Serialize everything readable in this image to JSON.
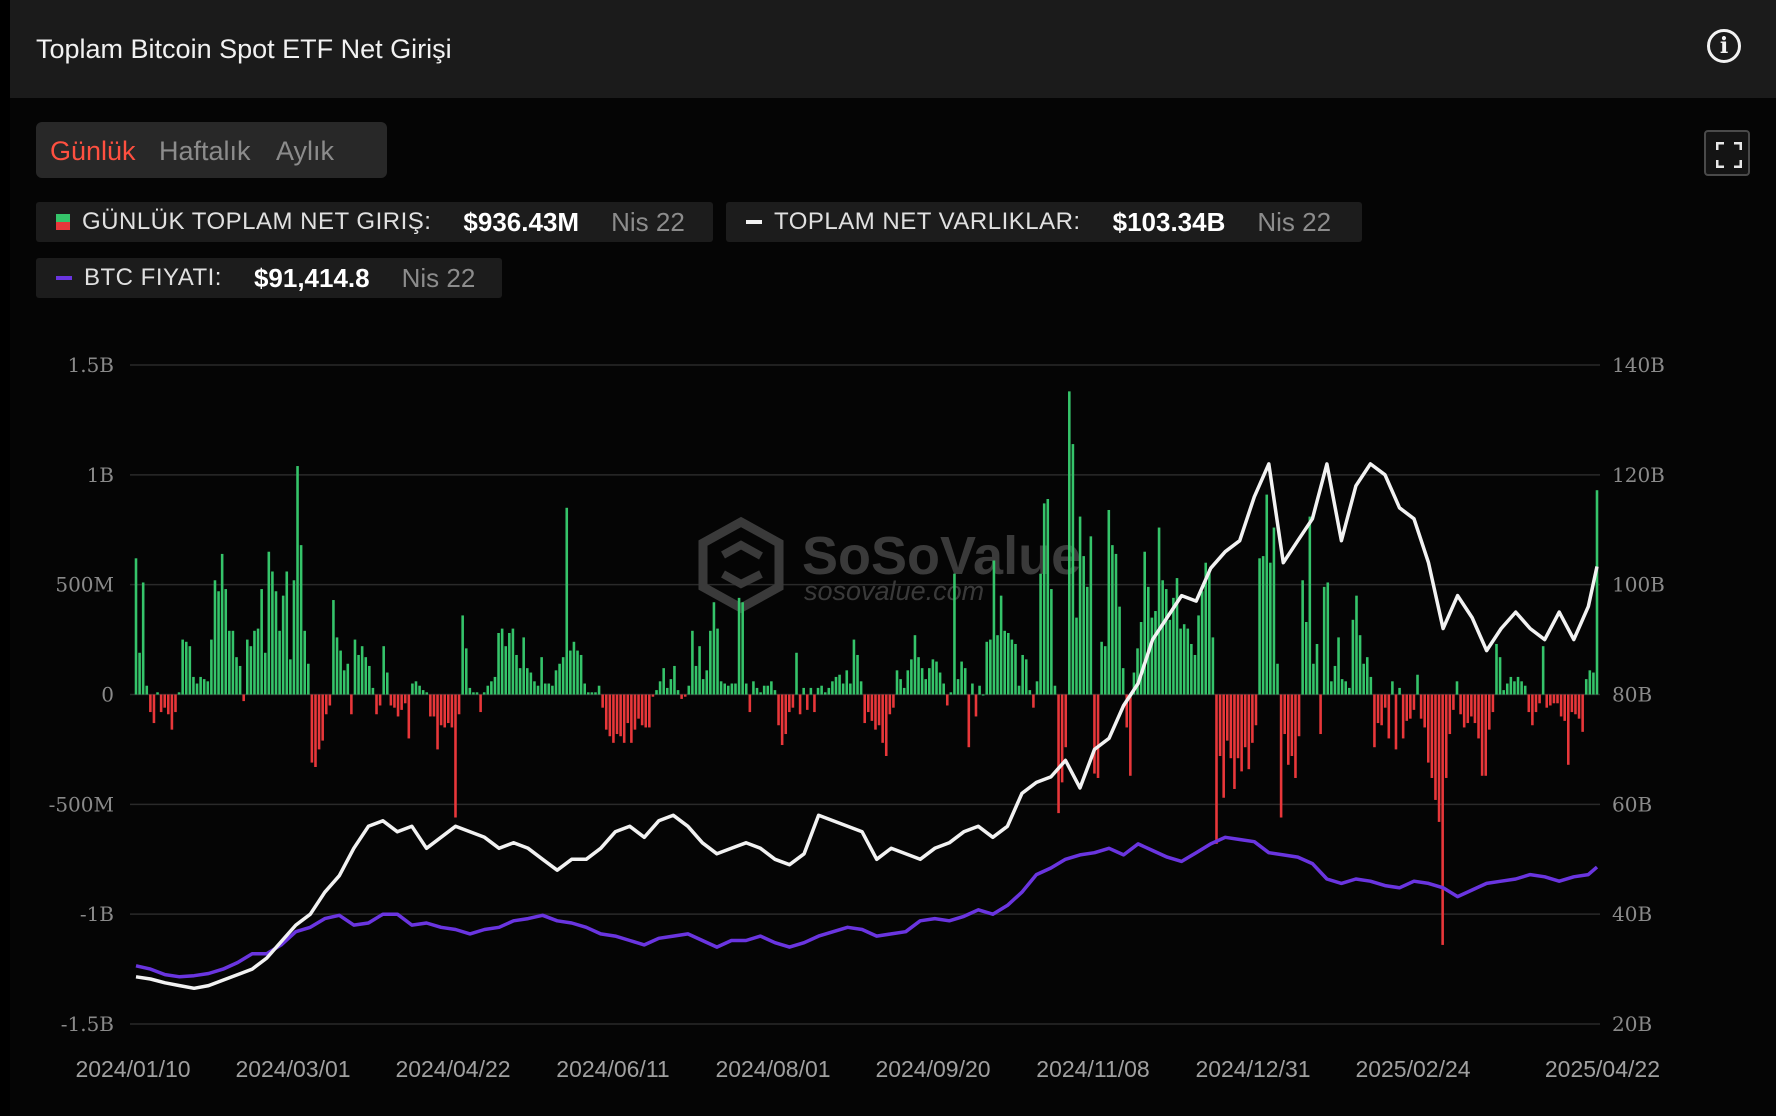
{
  "header": {
    "title": "Toplam Bitcoin Spot ETF Net Girişi",
    "info_icon": "info-icon"
  },
  "tabs": [
    {
      "label": "Günlük",
      "active": true
    },
    {
      "label": "Haftalık",
      "active": false
    },
    {
      "label": "Aylık",
      "active": false
    }
  ],
  "legend": {
    "daily": {
      "label": "GÜNLÜK TOPLAM NET GIRIŞ:",
      "value": "$936.43M",
      "date": "Nis 22"
    },
    "assets": {
      "label": "TOPLAM NET VARLIKLAR:",
      "value": "$103.34B",
      "date": "Nis 22"
    },
    "price": {
      "label": "BTC FIYATI:",
      "value": "$91,414.8",
      "date": "Nis 22"
    }
  },
  "watermark": {
    "brand": "SoSoValue",
    "site": "sosovalue.com"
  },
  "colors": {
    "inflow": "#35c46a",
    "outflow": "#e8373a",
    "assets": "#f2f2f2",
    "price": "#6a35e0",
    "active_tab": "#ff5040"
  },
  "chart_data": {
    "type": "bar+line",
    "left_axis": {
      "ticks": [
        "1.5B",
        "1B",
        "500M",
        "0",
        "-500M",
        "-1B",
        "-1.5B"
      ],
      "range": [
        -1.5,
        1.5
      ]
    },
    "right_axis": {
      "ticks": [
        "140B",
        "120B",
        "100B",
        "80B",
        "60B",
        "40B",
        "20B"
      ],
      "range": [
        20,
        140
      ]
    },
    "x_ticks": [
      "2024/01/10",
      "2024/03/01",
      "2024/04/22",
      "2024/06/11",
      "2024/08/01",
      "2024/09/20",
      "2024/11/08",
      "2024/12/31",
      "2025/02/24",
      "2025/04/22"
    ],
    "daily_flows_billions": [
      0.62,
      0.19,
      0.51,
      0.04,
      -0.08,
      -0.13,
      0.01,
      -0.08,
      -0.06,
      -0.09,
      -0.16,
      -0.08,
      0.01,
      0.25,
      0.24,
      0.22,
      0.08,
      0.05,
      0.08,
      0.07,
      0.06,
      0.25,
      0.52,
      0.47,
      0.64,
      0.48,
      0.29,
      0.29,
      0.17,
      0.13,
      -0.03,
      0.25,
      0.22,
      0.29,
      0.3,
      0.48,
      0.19,
      0.65,
      0.56,
      0.47,
      0.29,
      0.45,
      0.56,
      0.16,
      0.52,
      1.04,
      0.68,
      0.29,
      0.14,
      -0.31,
      -0.33,
      -0.25,
      -0.21,
      -0.09,
      -0.05,
      0.43,
      0.26,
      0.2,
      0.11,
      0.14,
      -0.09,
      0.25,
      0.18,
      0.22,
      0.17,
      0.13,
      0.03,
      -0.09,
      -0.05,
      0.22,
      0.1,
      -0.05,
      -0.06,
      -0.1,
      -0.07,
      -0.04,
      -0.2,
      0.05,
      0.06,
      0.04,
      0.02,
      0.01,
      -0.1,
      -0.1,
      -0.25,
      -0.14,
      -0.15,
      -0.13,
      -0.15,
      -0.56,
      -0.09,
      0.36,
      0.21,
      0.03,
      0.01,
      0.01,
      -0.08,
      0.01,
      0.04,
      0.06,
      0.08,
      0.28,
      0.3,
      0.22,
      0.28,
      0.3,
      0.18,
      0.12,
      0.26,
      0.12,
      0.1,
      0.06,
      0.04,
      0.17,
      0.05,
      0.05,
      0.04,
      0.11,
      0.14,
      0.17,
      0.85,
      0.2,
      0.24,
      0.2,
      0.18,
      0.05,
      0.01,
      0.01,
      0.01,
      0.04,
      -0.06,
      -0.16,
      -0.19,
      -0.22,
      -0.18,
      -0.19,
      -0.22,
      -0.13,
      -0.22,
      -0.16,
      -0.11,
      -0.14,
      -0.15,
      -0.15,
      -0.01,
      0.02,
      0.06,
      0.12,
      0.03,
      0.07,
      0.13,
      0.02,
      -0.02,
      -0.01,
      0.04,
      0.29,
      0.13,
      0.22,
      0.07,
      0.11,
      0.29,
      0.42,
      0.3,
      0.06,
      0.05,
      0.04,
      0.05,
      0.05,
      0.44,
      0.42,
      0.05,
      -0.08,
      0.06,
      0.03,
      0.01,
      0.04,
      0.04,
      0.06,
      0.02,
      -0.14,
      -0.23,
      -0.18,
      -0.08,
      -0.06,
      0.19,
      -0.09,
      0.03,
      -0.07,
      0.03,
      -0.08,
      0.03,
      0.04,
      0.01,
      0.03,
      0.06,
      0.08,
      0.09,
      0.05,
      0.11,
      0.05,
      0.25,
      0.18,
      0.06,
      -0.13,
      -0.08,
      -0.12,
      -0.16,
      -0.14,
      -0.22,
      -0.28,
      -0.09,
      -0.06,
      0.11,
      0.07,
      0.03,
      0.11,
      0.16,
      0.27,
      0.17,
      0.12,
      0.07,
      0.12,
      0.16,
      0.15,
      0.1,
      0.05,
      -0.05,
      0.01,
      0.55,
      0.07,
      0.15,
      0.12,
      -0.24,
      0.05,
      -0.1,
      0.04,
      0.0,
      0.24,
      0.25,
      0.61,
      0.27,
      0.45,
      0.29,
      0.28,
      0.25,
      0.23,
      0.04,
      0.18,
      0.16,
      0.02,
      -0.06,
      0.06,
      0.55,
      0.87,
      0.89,
      0.48,
      0.04,
      -0.54,
      -0.4,
      -0.24,
      1.38,
      1.14,
      0.35,
      0.81,
      0.63,
      0.49,
      0.72,
      -0.36,
      -0.38,
      0.24,
      0.22,
      0.84,
      0.68,
      0.64,
      0.4,
      0.12,
      -0.15,
      -0.37,
      0.1,
      0.21,
      0.33,
      0.65,
      0.49,
      0.35,
      0.38,
      0.76,
      0.52,
      0.48,
      0.34,
      0.44,
      0.53,
      0.3,
      0.32,
      0.3,
      0.23,
      0.18,
      0.36,
      0.47,
      0.6,
      0.57,
      0.26,
      -0.68,
      -0.28,
      -0.47,
      -0.21,
      -0.29,
      -0.43,
      -0.29,
      -0.35,
      -0.24,
      -0.34,
      -0.22,
      -0.14,
      0.62,
      0.63,
      0.91,
      0.6,
      0.76,
      0.14,
      -0.56,
      -0.18,
      -0.32,
      -0.28,
      -0.38,
      -0.19,
      0.52,
      0.33,
      0.81,
      0.14,
      0.23,
      -0.18,
      0.49,
      0.51,
      0.06,
      0.13,
      0.26,
      0.07,
      0.06,
      0.03,
      0.34,
      0.45,
      0.27,
      0.14,
      0.17,
      0.08,
      -0.24,
      -0.13,
      -0.14,
      -0.06,
      -0.2,
      0.06,
      -0.25,
      0.03,
      -0.2,
      -0.12,
      -0.11,
      -0.07,
      0.09,
      -0.11,
      -0.15,
      -0.31,
      -0.38,
      -0.48,
      -0.58,
      -1.14,
      -0.38,
      -0.18,
      -0.07,
      0.06,
      -0.09,
      -0.15,
      -0.13,
      -0.1,
      -0.13,
      -0.2,
      -0.37,
      -0.37,
      -0.16,
      -0.08,
      0.23,
      0.17,
      0.02,
      0.05,
      0.08,
      0.06,
      0.08,
      0.06,
      0.04,
      -0.08,
      -0.14,
      -0.08,
      -0.04,
      0.22,
      -0.06,
      -0.05,
      -0.04,
      -0.04,
      -0.1,
      -0.12,
      -0.32,
      -0.08,
      -0.09,
      -0.11,
      -0.17,
      0.07,
      0.11,
      0.1,
      0.93
    ],
    "total_net_assets_billions": [
      [
        0,
        28.6
      ],
      [
        5,
        28.2
      ],
      [
        10,
        27.5
      ],
      [
        15,
        27.0
      ],
      [
        20,
        26.5
      ],
      [
        25,
        27.0
      ],
      [
        30,
        28.0
      ],
      [
        35,
        29.0
      ],
      [
        40,
        30.0
      ],
      [
        45,
        32.0
      ],
      [
        50,
        35.0
      ],
      [
        55,
        38.0
      ],
      [
        60,
        40.0
      ],
      [
        65,
        44.0
      ],
      [
        70,
        47.0
      ],
      [
        75,
        52.0
      ],
      [
        80,
        56.0
      ],
      [
        85,
        57.0
      ],
      [
        90,
        55.0
      ],
      [
        95,
        56.0
      ],
      [
        100,
        52.0
      ],
      [
        105,
        54.0
      ],
      [
        110,
        56.0
      ],
      [
        115,
        55.0
      ],
      [
        120,
        54.0
      ],
      [
        125,
        52.0
      ],
      [
        130,
        53.0
      ],
      [
        135,
        52.0
      ],
      [
        140,
        50.0
      ],
      [
        145,
        48.0
      ],
      [
        150,
        50.0
      ],
      [
        155,
        50.0
      ],
      [
        160,
        52.0
      ],
      [
        165,
        55.0
      ],
      [
        170,
        56.0
      ],
      [
        175,
        54.0
      ],
      [
        180,
        57.0
      ],
      [
        185,
        58.0
      ],
      [
        190,
        56.0
      ],
      [
        195,
        53.0
      ],
      [
        200,
        51.0
      ],
      [
        205,
        52.0
      ],
      [
        210,
        53.0
      ],
      [
        215,
        52.0
      ],
      [
        220,
        50.0
      ],
      [
        225,
        49.0
      ],
      [
        230,
        51.0
      ],
      [
        235,
        58.0
      ],
      [
        240,
        57.0
      ],
      [
        245,
        56.0
      ],
      [
        250,
        55.0
      ],
      [
        255,
        50.0
      ],
      [
        260,
        52.0
      ],
      [
        265,
        51.0
      ],
      [
        270,
        50.0
      ],
      [
        275,
        52.0
      ],
      [
        280,
        53.0
      ],
      [
        285,
        55.0
      ],
      [
        290,
        56.0
      ],
      [
        295,
        54.0
      ],
      [
        300,
        56.0
      ],
      [
        305,
        62.0
      ],
      [
        310,
        64.0
      ],
      [
        315,
        65.0
      ],
      [
        320,
        68.0
      ],
      [
        325,
        63.0
      ],
      [
        330,
        70.0
      ],
      [
        335,
        72.0
      ],
      [
        340,
        78.0
      ],
      [
        345,
        82.0
      ],
      [
        350,
        90.0
      ],
      [
        355,
        94.0
      ],
      [
        360,
        98.0
      ],
      [
        365,
        97.0
      ],
      [
        370,
        103.0
      ],
      [
        375,
        106.0
      ],
      [
        380,
        108.0
      ],
      [
        385,
        116.0
      ],
      [
        390,
        122.0
      ],
      [
        395,
        104.0
      ],
      [
        400,
        108.0
      ],
      [
        405,
        112.0
      ],
      [
        410,
        122.0
      ],
      [
        415,
        108.0
      ],
      [
        420,
        118.0
      ],
      [
        425,
        122.0
      ],
      [
        430,
        120.0
      ],
      [
        435,
        114.0
      ],
      [
        440,
        112.0
      ],
      [
        445,
        104.0
      ],
      [
        450,
        92.0
      ],
      [
        455,
        98.0
      ],
      [
        460,
        94.0
      ],
      [
        465,
        88.0
      ],
      [
        470,
        92.0
      ],
      [
        475,
        95.0
      ],
      [
        480,
        92.0
      ],
      [
        485,
        90.0
      ],
      [
        490,
        95.0
      ],
      [
        495,
        90.0
      ],
      [
        500,
        96.0
      ],
      [
        503,
        103.3
      ]
    ],
    "btc_price_usd": [
      [
        0,
        46500
      ],
      [
        5,
        45000
      ],
      [
        10,
        42500
      ],
      [
        15,
        41500
      ],
      [
        20,
        42000
      ],
      [
        25,
        43000
      ],
      [
        30,
        45000
      ],
      [
        35,
        48000
      ],
      [
        40,
        52000
      ],
      [
        45,
        52000
      ],
      [
        50,
        56000
      ],
      [
        55,
        62000
      ],
      [
        60,
        64000
      ],
      [
        65,
        68000
      ],
      [
        70,
        69500
      ],
      [
        75,
        65000
      ],
      [
        80,
        66000
      ],
      [
        85,
        70000
      ],
      [
        90,
        70000
      ],
      [
        95,
        65000
      ],
      [
        100,
        66000
      ],
      [
        105,
        64000
      ],
      [
        110,
        63000
      ],
      [
        115,
        61000
      ],
      [
        120,
        63000
      ],
      [
        125,
        64000
      ],
      [
        130,
        67000
      ],
      [
        135,
        68000
      ],
      [
        140,
        69500
      ],
      [
        145,
        67000
      ],
      [
        150,
        66000
      ],
      [
        155,
        64000
      ],
      [
        160,
        61000
      ],
      [
        165,
        60000
      ],
      [
        170,
        58000
      ],
      [
        175,
        56000
      ],
      [
        180,
        59000
      ],
      [
        185,
        60000
      ],
      [
        190,
        61000
      ],
      [
        195,
        58000
      ],
      [
        200,
        55000
      ],
      [
        205,
        58000
      ],
      [
        210,
        58000
      ],
      [
        215,
        60000
      ],
      [
        220,
        57000
      ],
      [
        225,
        55000
      ],
      [
        230,
        57000
      ],
      [
        235,
        60000
      ],
      [
        240,
        62000
      ],
      [
        245,
        64000
      ],
      [
        250,
        63000
      ],
      [
        255,
        60000
      ],
      [
        260,
        61000
      ],
      [
        265,
        62000
      ],
      [
        270,
        67000
      ],
      [
        275,
        68000
      ],
      [
        280,
        67000
      ],
      [
        285,
        69000
      ],
      [
        290,
        72000
      ],
      [
        295,
        70000
      ],
      [
        300,
        74000
      ],
      [
        305,
        80000
      ],
      [
        310,
        88000
      ],
      [
        315,
        91000
      ],
      [
        320,
        95000
      ],
      [
        325,
        97000
      ],
      [
        330,
        98000
      ],
      [
        335,
        100000
      ],
      [
        340,
        97000
      ],
      [
        345,
        102000
      ],
      [
        350,
        99000
      ],
      [
        355,
        96000
      ],
      [
        360,
        94000
      ],
      [
        365,
        98000
      ],
      [
        370,
        102000
      ],
      [
        375,
        105000
      ],
      [
        380,
        104000
      ],
      [
        385,
        103000
      ],
      [
        390,
        98000
      ],
      [
        395,
        97000
      ],
      [
        400,
        96000
      ],
      [
        405,
        93000
      ],
      [
        410,
        86000
      ],
      [
        415,
        84000
      ],
      [
        420,
        86000
      ],
      [
        425,
        85000
      ],
      [
        430,
        83000
      ],
      [
        435,
        82000
      ],
      [
        440,
        85000
      ],
      [
        445,
        84000
      ],
      [
        450,
        82000
      ],
      [
        455,
        78000
      ],
      [
        460,
        81000
      ],
      [
        465,
        84000
      ],
      [
        470,
        85000
      ],
      [
        475,
        86000
      ],
      [
        480,
        88000
      ],
      [
        485,
        87000
      ],
      [
        490,
        85000
      ],
      [
        495,
        87000
      ],
      [
        500,
        88000
      ],
      [
        503,
        91414.8
      ]
    ],
    "price_axis_note": ""
  }
}
